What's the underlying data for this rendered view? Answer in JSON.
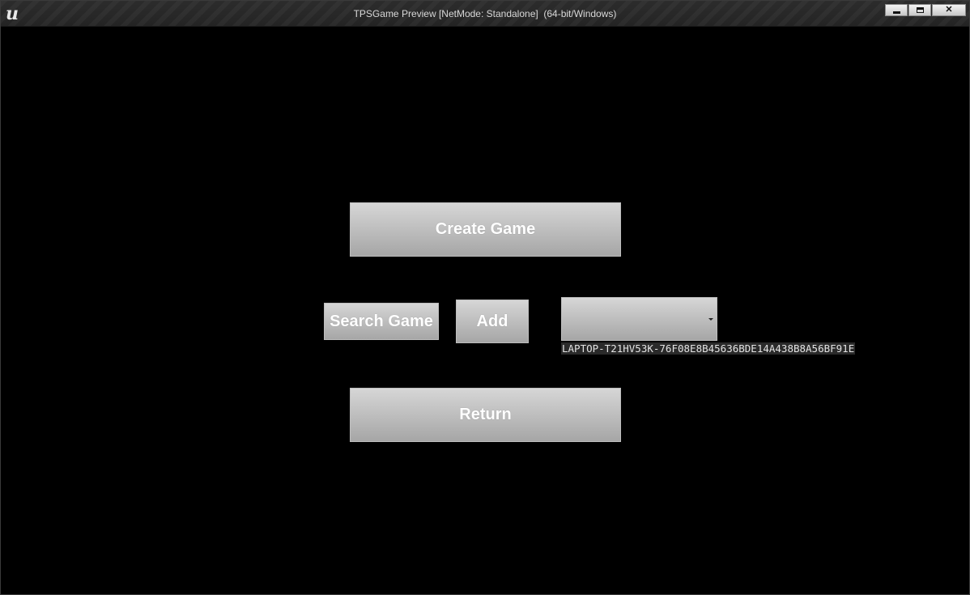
{
  "window": {
    "title": "TPSGame Preview [NetMode: Standalone]  (64-bit/Windows)",
    "logo_glyph": "u",
    "close_glyph": "✕"
  },
  "menu": {
    "create_game_label": "Create Game",
    "search_game_label": "Search Game",
    "add_label": "Add",
    "return_label": "Return"
  },
  "session": {
    "selected_value": "",
    "session_id": "LAPTOP-T21HV53K-76F08E8B45636BDE14A438B8A56BF91E"
  },
  "icons": {
    "logo": "unreal-engine-logo-icon",
    "minimize": "minimize-icon",
    "maximize": "maximize-icon",
    "close": "close-icon",
    "dropdown": "chevron-down-icon"
  },
  "colors": {
    "background": "#000000",
    "button_top": "#d6d6d6",
    "button_bottom": "#a6a6a6",
    "button_text": "#ffffff",
    "titlebar": "#2a2a2a"
  }
}
